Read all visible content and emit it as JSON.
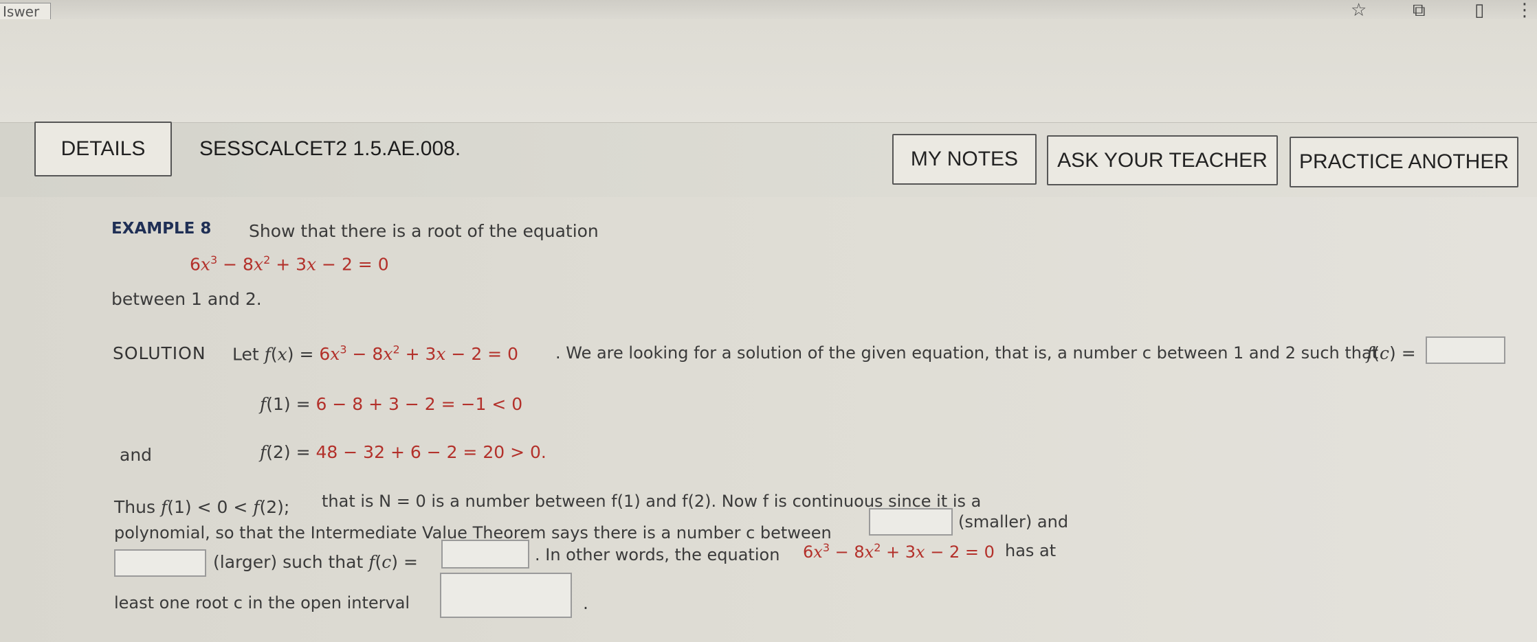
{
  "browser": {
    "prev_label": "Iswer",
    "icons": [
      "star-icon",
      "extension-icon",
      "sidebar-icon",
      "kebab-menu-icon"
    ]
  },
  "header": {
    "details_label": "DETAILS",
    "question_id": "SESSCALCET2 1.5.AE.008.",
    "my_notes_label": "MY NOTES",
    "ask_teacher_label": "ASK YOUR TEACHER",
    "practice_label": "PRACTICE ANOTHER"
  },
  "example": {
    "label": "EXAMPLE 8",
    "prompt": "Show that there is a root of the equation",
    "between": "between 1 and 2."
  },
  "solution": {
    "label": "SOLUTION",
    "sentence_tail": ". We are looking for a solution of the given equation, that is, a number c between 1 and 2 such that",
    "f1_rhs": "6 − 8 + 3 − 2 = −1 < 0",
    "and_label": "and",
    "f2_rhs": "48 − 32 + 6 − 2 = 20 > 0."
  },
  "conclusion": {
    "line1_a": "Thus",
    "line1_b": "that is N = 0 is a number between f(1) and f(2). Now f is continuous since it is a",
    "line2_a": "polynomial, so that the Intermediate Value Theorem says there is a number c between",
    "line2_b": "(smaller) and",
    "line3_a": "(larger) such that",
    "line3_b": ". In other words, the equation",
    "line3_c": "has at",
    "line4_a": "least one root c in the open interval"
  },
  "answers": {
    "fc_value": "",
    "smaller": "",
    "larger": "",
    "fc_value_2": "",
    "interval": ""
  }
}
